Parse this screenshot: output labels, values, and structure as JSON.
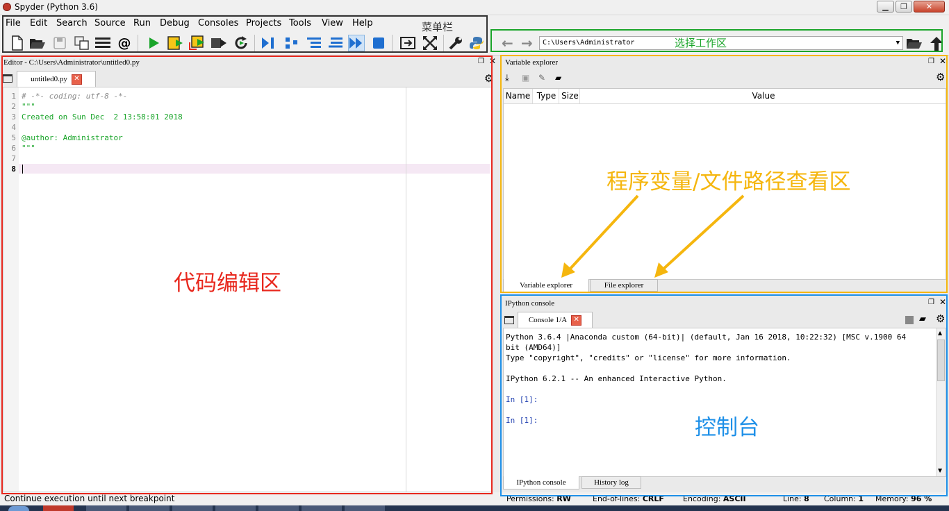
{
  "window": {
    "title": "Spyder (Python 3.6)"
  },
  "menu": {
    "items": [
      "File",
      "Edit",
      "Search",
      "Source",
      "Run",
      "Debug",
      "Consoles",
      "Projects",
      "Tools",
      "View",
      "Help"
    ],
    "annotation": "菜单栏"
  },
  "workdir": {
    "path": "C:\\Users\\Administrator",
    "annotation": "选择工作区"
  },
  "editor": {
    "header": "Editor - C:\\Users\\Administrator\\untitled0.py",
    "tab": "untitled0.py",
    "lines": [
      {
        "n": "1",
        "text": "# -*- coding: utf-8 -*-"
      },
      {
        "n": "2",
        "text": "\"\"\""
      },
      {
        "n": "3",
        "text": "Created on Sun Dec  2 13:58:01 2018"
      },
      {
        "n": "4",
        "text": ""
      },
      {
        "n": "5",
        "text": "@author: Administrator"
      },
      {
        "n": "6",
        "text": "\"\"\""
      },
      {
        "n": "7",
        "text": ""
      },
      {
        "n": "8",
        "text": ""
      }
    ],
    "annotation": "代码编辑区"
  },
  "variable_explorer": {
    "header": "Variable explorer",
    "columns": [
      "Name",
      "Type",
      "Size",
      "Value"
    ],
    "tabs": [
      "Variable explorer",
      "File explorer"
    ],
    "annotation": "程序变量/文件路径查看区"
  },
  "console": {
    "header": "IPython console",
    "tab": "Console 1/A",
    "lines": [
      "Python 3.6.4 |Anaconda custom (64-bit)| (default, Jan 16 2018, 10:22:32) [MSC v.1900 64",
      "bit (AMD64)]",
      "Type \"copyright\", \"credits\" or \"license\" for more information.",
      "",
      "IPython 6.2.1 -- An enhanced Interactive Python.",
      "",
      "In [1]:",
      "",
      "In [1]:"
    ],
    "tabs": [
      "IPython console",
      "History log"
    ],
    "annotation": "控制台"
  },
  "statusbar": {
    "message": "Continue execution until next breakpoint",
    "permissions_label": "Permissions:",
    "permissions": "RW",
    "eol_label": "End-of-lines:",
    "eol": "CRLF",
    "encoding_label": "Encoding:",
    "encoding": "ASCII",
    "line_label": "Line:",
    "line": "8",
    "column_label": "Column:",
    "column": "1",
    "memory_label": "Memory:",
    "memory": "96 %"
  },
  "colors": {
    "annot_red": "#e8281e",
    "annot_green": "#1aa52a",
    "annot_orange": "#f5b60e",
    "annot_blue": "#1e90e8",
    "annot_dark": "#333333"
  }
}
